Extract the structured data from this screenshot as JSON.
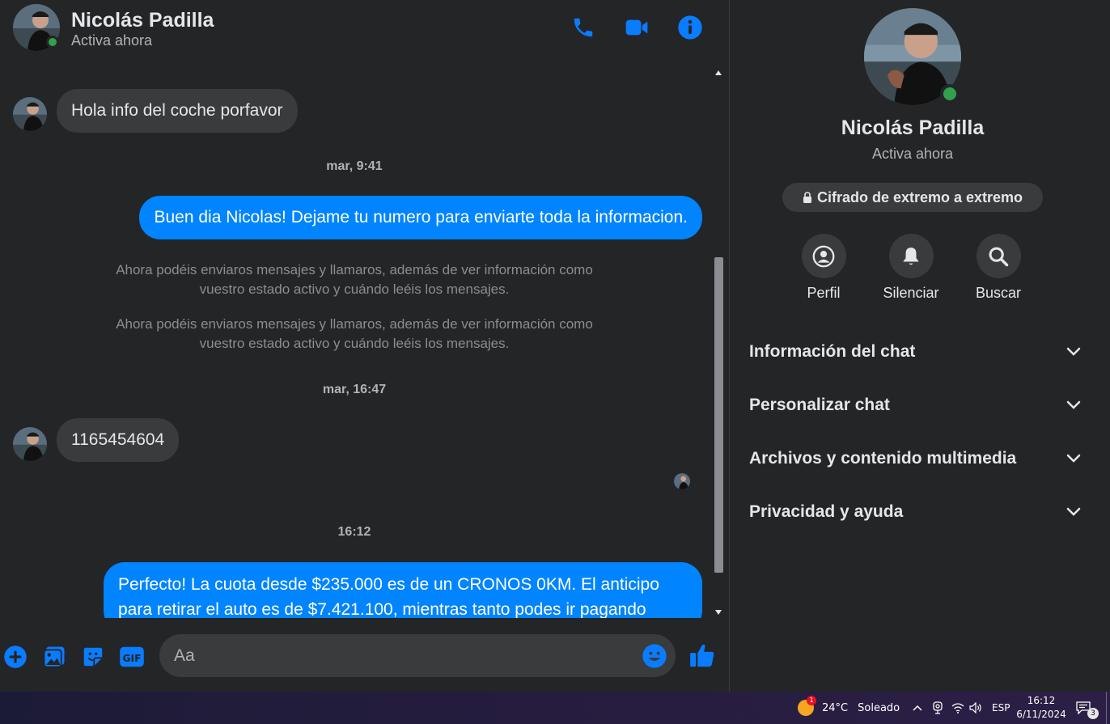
{
  "header": {
    "name": "Nicolás Padilla",
    "status": "Activa ahora",
    "icons": [
      "phone-icon",
      "video-camera-icon",
      "info-icon"
    ]
  },
  "thread": {
    "messages": [
      {
        "side": "in",
        "text": "Hola info del coche porfavor"
      },
      {
        "type": "timestamp",
        "text": "mar, 9:41"
      },
      {
        "side": "out",
        "text": "Buen dia Nicolas! Dejame tu numero para enviarte toda la informacion."
      },
      {
        "type": "system",
        "line1": "Ahora podéis enviaros mensajes y llamaros, además de ver información como",
        "line2": "vuestro estado activo y cuándo leéis los mensajes."
      },
      {
        "type": "system",
        "line1": "Ahora podéis enviaros mensajes y llamaros, además de ver información como",
        "line2": "vuestro estado activo y cuándo leéis los mensajes."
      },
      {
        "type": "timestamp",
        "text": "mar, 16:47"
      },
      {
        "side": "in",
        "text": "1165454604"
      },
      {
        "type": "timestamp",
        "text": "16:12"
      },
      {
        "side": "out",
        "text": "Perfecto! La cuota desde $235.000 es de un CRONOS 0KM. El anticipo para retirar el auto es de $7.421.100, mientras tanto podes ir pagando"
      }
    ]
  },
  "composer": {
    "placeholder": "Aa",
    "icons": [
      "plus-icon",
      "image-icon",
      "sticker-icon",
      "gif-icon",
      "emoji-icon",
      "like-icon"
    ]
  },
  "info_panel": {
    "name": "Nicolás Padilla",
    "status": "Activa ahora",
    "encryption_label": "Cifrado de extremo a extremo",
    "actions": [
      {
        "label": "Perfil",
        "icon": "profile-icon"
      },
      {
        "label": "Silenciar",
        "icon": "bell-icon"
      },
      {
        "label": "Buscar",
        "icon": "search-icon"
      }
    ],
    "sections": [
      {
        "label": "Información del chat"
      },
      {
        "label": "Personalizar chat"
      },
      {
        "label": "Archivos y contenido multimedia"
      },
      {
        "label": "Privacidad y ayuda"
      }
    ]
  },
  "taskbar": {
    "weather_badge": "1",
    "temperature": "24°C",
    "condition": "Soleado",
    "language": "ESP",
    "time": "16:12",
    "date": "6/11/2024",
    "notification_count": "3"
  },
  "colors": {
    "accent": "#0084ff",
    "background": "#242526",
    "bubble_incoming": "#3a3b3c",
    "online": "#31a24c"
  }
}
